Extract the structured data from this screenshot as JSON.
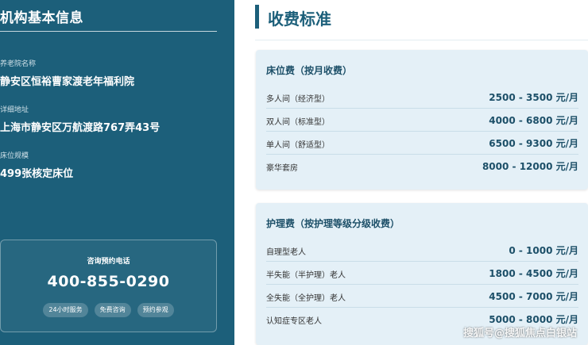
{
  "institution": {
    "section_title": "机构基本信息",
    "fields": [
      {
        "label": "养老院名称",
        "value": "静安区恒裕曹家渡老年福利院"
      },
      {
        "label": "详细地址",
        "value": "上海市静安区万航渡路767弄43号"
      },
      {
        "label": "床位规模",
        "value": "499张核定床位"
      }
    ],
    "contact": {
      "label": "咨询预约电话",
      "phone": "400-855-0290",
      "tags": [
        "24小时服务",
        "免费咨询",
        "预约参观"
      ]
    }
  },
  "fees": {
    "title": "收费标准",
    "cards": [
      {
        "title": "床位费（按月收费）",
        "rows": [
          {
            "label": "多人间（经济型）",
            "price": "2500 - 3500 元/月"
          },
          {
            "label": "双人间（标准型）",
            "price": "4000 - 6800 元/月"
          },
          {
            "label": "单人间（舒适型）",
            "price": "6500 - 9300 元/月"
          },
          {
            "label": "豪华套房",
            "price": "8000 - 12000 元/月"
          }
        ]
      },
      {
        "title": "护理费（按护理等级分级收费）",
        "rows": [
          {
            "label": "自理型老人",
            "price": "0 - 1000 元/月"
          },
          {
            "label": "半失能（半护理）老人",
            "price": "1800 - 4500 元/月"
          },
          {
            "label": "全失能（全护理）老人",
            "price": "4500 - 7000 元/月"
          },
          {
            "label": "认知症专区老人",
            "price": "5000 - 8000 元/月"
          }
        ]
      }
    ]
  },
  "watermark": "搜狐号@搜狐焦点白银站"
}
